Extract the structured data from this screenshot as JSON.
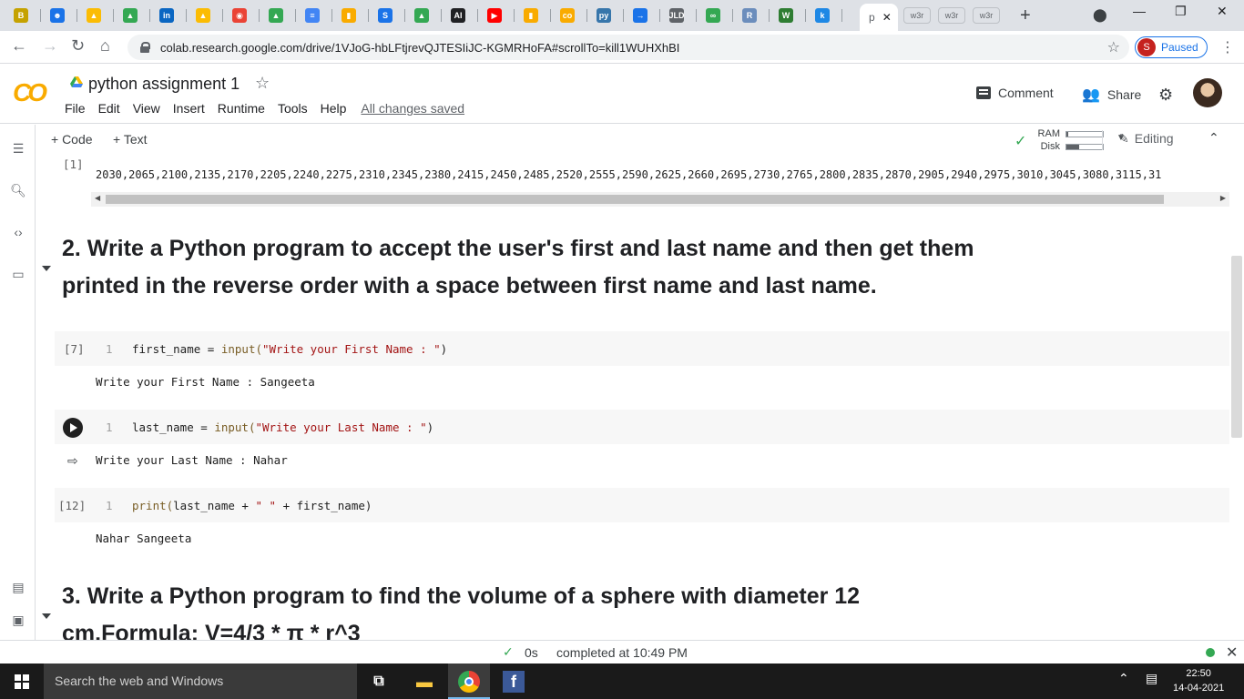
{
  "browser": {
    "tabs": [
      {
        "icon": "mail-icon",
        "label": "B",
        "color": "#c5a200"
      },
      {
        "icon": "contacts-icon",
        "label": "☻",
        "color": "#1a73e8"
      },
      {
        "icon": "drive-icon",
        "label": "▲",
        "color": "#fbbc04"
      },
      {
        "icon": "drive-icon",
        "label": "▲",
        "color": "#34a853"
      },
      {
        "icon": "linkedin-icon",
        "label": "in",
        "color": "#0a66c2"
      },
      {
        "icon": "drive-icon",
        "label": "▲",
        "color": "#fbbc04"
      },
      {
        "icon": "chrome-icon",
        "label": "◉",
        "color": "#ea4335"
      },
      {
        "icon": "drive-icon",
        "label": "▲",
        "color": "#34a853"
      },
      {
        "icon": "docs-icon",
        "label": "≡",
        "color": "#4285f4"
      },
      {
        "icon": "analytics-icon",
        "label": "▮",
        "color": "#f9ab00"
      },
      {
        "icon": "s-icon",
        "label": "S",
        "color": "#1a73e8"
      },
      {
        "icon": "drive-icon",
        "label": "▲",
        "color": "#34a853"
      },
      {
        "icon": "ai-icon",
        "label": "AI",
        "color": "#202124"
      },
      {
        "icon": "youtube-icon",
        "label": "▶",
        "color": "#ff0000"
      },
      {
        "icon": "analytics-icon",
        "label": "▮",
        "color": "#f9ab00"
      },
      {
        "icon": "colab-icon",
        "label": "co",
        "color": "#f9ab00"
      },
      {
        "icon": "python-icon",
        "label": "py",
        "color": "#3776ab"
      },
      {
        "icon": "arrow-icon",
        "label": "→",
        "color": "#1a73e8"
      },
      {
        "icon": "jld-icon",
        "label": "JLD",
        "color": "#5f6368"
      },
      {
        "icon": "infinity-icon",
        "label": "∞",
        "color": "#34a853"
      },
      {
        "icon": "r-icon",
        "label": "R",
        "color": "#6b8dbc"
      },
      {
        "icon": "w-icon",
        "label": "W",
        "color": "#2e7d32"
      },
      {
        "icon": "k-icon",
        "label": "k",
        "color": "#1e88e5"
      }
    ],
    "active_tab_label": "p",
    "extra_tabs": [
      "w3r",
      "w3r",
      "w3r"
    ],
    "url": "colab.research.google.com/drive/1VJoG-hbLFtjrevQJTESIiJC-KGMRHoFA#scrollTo=kill1WUHXhBI",
    "profile_initial": "S",
    "profile_status": "Paused"
  },
  "colab": {
    "logo": "CO",
    "title": "python assignment 1",
    "menu": [
      "File",
      "Edit",
      "View",
      "Insert",
      "Runtime",
      "Tools",
      "Help"
    ],
    "save_status": "All changes saved",
    "comment_label": "Comment",
    "share_label": "Share",
    "add_code": "+ Code",
    "add_text": "+ Text",
    "ram_label": "RAM",
    "disk_label": "Disk",
    "ram_usage": 0.05,
    "disk_usage": 0.35,
    "editing_label": "Editing"
  },
  "notebook": {
    "prev_exec_count": "[1]",
    "prev_output": "2030,2065,2100,2135,2170,2205,2240,2275,2310,2345,2380,2415,2450,2485,2520,2555,2590,2625,2660,2695,2730,2765,2800,2835,2870,2905,2940,2975,3010,3045,3080,3115,31",
    "heading2_line1": "2. Write a Python program to accept the user's first and last name and then get them",
    "heading2_line2": "printed in the reverse order with a space between first name and last name.",
    "cells": [
      {
        "exec": "[7]",
        "line_no": "1",
        "code_var": "first_name = ",
        "code_func": "input(",
        "code_str": "\"Write your First Name : \"",
        "code_end": ")",
        "output": "Write your First Name : Sangeeta"
      },
      {
        "exec": "",
        "line_no": "1",
        "code_var": "last_name = ",
        "code_func": "input(",
        "code_str": "\"Write your Last Name : \"",
        "code_end": ")",
        "output": "Write your Last Name : Nahar"
      },
      {
        "exec": "[12]",
        "line_no": "1",
        "code_var": "",
        "code_func": "print(",
        "code_str": "\" \"",
        "code_pre": "last_name + ",
        "code_post": " + first_name",
        "code_end": ")",
        "output": "Nahar Sangeeta"
      }
    ],
    "heading3_line1": "3. Write a Python program to find the volume of a sphere with diameter 12",
    "heading3_line2": "cm.Formula: V=4/3 * π * r^3"
  },
  "status": {
    "duration": "0s",
    "completed": "completed at 10:49 PM"
  },
  "taskbar": {
    "search_placeholder": "Search the web and Windows",
    "time": "22:50",
    "date": "14-04-2021"
  }
}
